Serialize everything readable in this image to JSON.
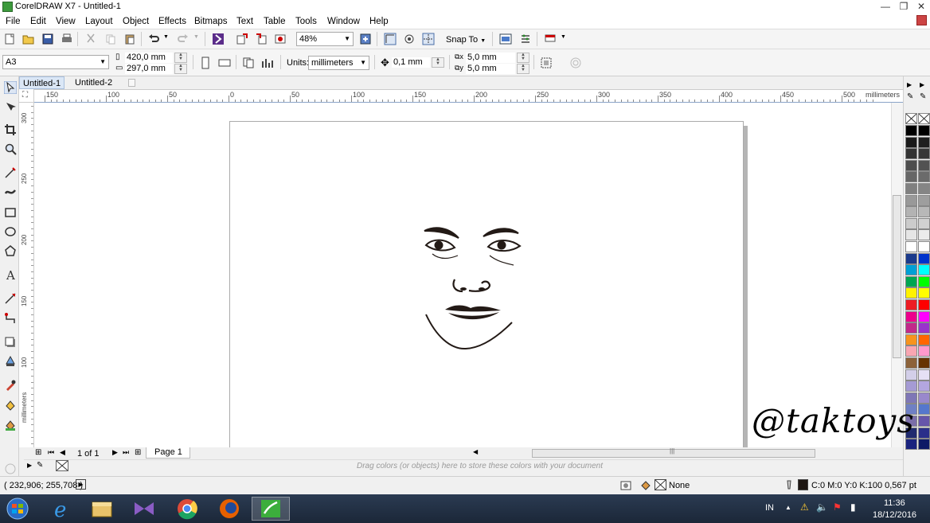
{
  "window": {
    "title": "CorelDRAW X7 - Untitled-1",
    "minimize": "—",
    "restore": "❐",
    "close": "✕"
  },
  "menu": [
    {
      "label": "File"
    },
    {
      "label": "Edit"
    },
    {
      "label": "View"
    },
    {
      "label": "Layout"
    },
    {
      "label": "Object"
    },
    {
      "label": "Effects"
    },
    {
      "label": "Bitmaps"
    },
    {
      "label": "Text"
    },
    {
      "label": "Table"
    },
    {
      "label": "Tools"
    },
    {
      "label": "Window"
    },
    {
      "label": "Help"
    }
  ],
  "toolbar": {
    "zoom": "48%",
    "snap_to": "Snap To"
  },
  "property_bar": {
    "page_size": "A3",
    "width": "420,0 mm",
    "height": "297,0 mm",
    "units_label": "Units:",
    "units": "millimeters",
    "nudge": "0,1 mm",
    "dup_x": "5,0 mm",
    "dup_y": "5,0 mm"
  },
  "tabs": [
    {
      "label": "Untitled-1"
    },
    {
      "label": "Untitled-2"
    }
  ],
  "ruler": {
    "h_labels": [
      "150",
      "100",
      "50",
      "0",
      "50",
      "100",
      "150",
      "200",
      "250",
      "300",
      "350",
      "400",
      "450",
      "500"
    ],
    "h_unit": "millimeters",
    "v_labels": [
      "300",
      "250",
      "200",
      "150",
      "100"
    ],
    "v_unit": "millimeters"
  },
  "page_nav": {
    "count": "1 of 1",
    "page_tab": "Page 1"
  },
  "doc_palette_hint": "Drag colors (or objects) here to store these colors with your document",
  "status": {
    "coords": "( 232,906; 255,708 )",
    "fill": "None",
    "outline": "C:0 M:0 Y:0 K:100  0,567 pt"
  },
  "watermark": "@taktoys",
  "taskbar": {
    "lang": "IN",
    "time": "11:36",
    "date": "18/12/2016"
  },
  "palette_colors": {
    "col1": [
      "#000000",
      "#1a1a1a",
      "#333333",
      "#4d4d4d",
      "#666666",
      "#808080",
      "#999999",
      "#b3b3b3",
      "#cccccc",
      "#e6e6e6",
      "#ffffff",
      "#1b3a8c",
      "#00a0d6",
      "#00a651",
      "#fff200",
      "#ed1c24",
      "#ec008c",
      "#c2288a",
      "#f7941d",
      "#f9a6b2",
      "#8c6239",
      "#d3cfe9",
      "#a59bd4",
      "#7f77b6",
      "#6f80c4",
      "#7a6ea8",
      "#202a6e",
      "#1a237e"
    ],
    "col2": [
      "#000000",
      "#1f1f1f",
      "#383838",
      "#525252",
      "#6b6b6b",
      "#858585",
      "#9e9e9e",
      "#b8b8b8",
      "#d1d1d1",
      "#ebebeb",
      "#ffffff",
      "#0033cc",
      "#00ffff",
      "#00ff00",
      "#ffff00",
      "#ff0000",
      "#ff00ff",
      "#9933cc",
      "#ff6600",
      "#ff99cc",
      "#663300",
      "#e6e0f5",
      "#b3a6e0",
      "#9988cc",
      "#5577cc",
      "#6655aa",
      "#2a2f8a",
      "#0d1a66"
    ]
  }
}
